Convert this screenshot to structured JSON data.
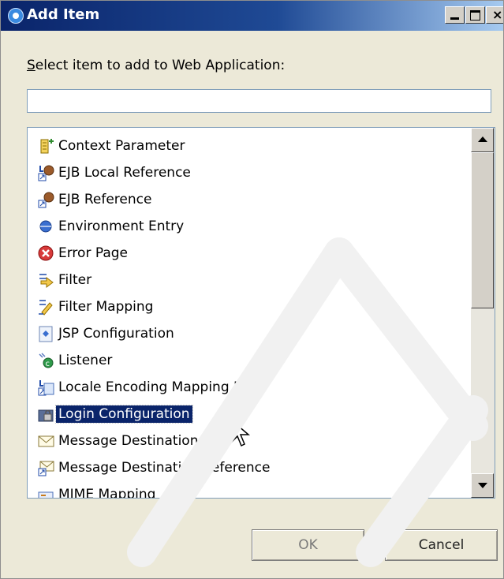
{
  "window": {
    "title": "Add Item"
  },
  "prompt": {
    "before": "",
    "mnemonic": "S",
    "after": "elect item to add to Web Application:"
  },
  "filter": {
    "value": "",
    "placeholder": ""
  },
  "list": {
    "items": [
      {
        "label": "Context Parameter",
        "icon": "context-parameter-icon"
      },
      {
        "label": "EJB Local Reference",
        "icon": "ejb-local-reference-icon"
      },
      {
        "label": "EJB Reference",
        "icon": "ejb-reference-icon"
      },
      {
        "label": "Environment Entry",
        "icon": "environment-entry-icon"
      },
      {
        "label": "Error Page",
        "icon": "error-page-icon"
      },
      {
        "label": "Filter",
        "icon": "filter-icon"
      },
      {
        "label": "Filter Mapping",
        "icon": "filter-mapping-icon"
      },
      {
        "label": "JSP Configuration",
        "icon": "jsp-configuration-icon"
      },
      {
        "label": "Listener",
        "icon": "listener-icon"
      },
      {
        "label": "Locale Encoding Mapping List",
        "icon": "locale-encoding-icon"
      },
      {
        "label": "Login Configuration",
        "icon": "login-configuration-icon"
      },
      {
        "label": "Message Destination",
        "icon": "message-destination-icon"
      },
      {
        "label": "Message Destination Reference",
        "icon": "message-destination-reference-icon"
      },
      {
        "label": "MIME Mapping",
        "icon": "mime-mapping-icon"
      }
    ],
    "selected_index": 10
  },
  "buttons": {
    "ok": "OK",
    "cancel": "Cancel"
  },
  "colors": {
    "title_bar": "#0a246a",
    "selection": "#0a246a",
    "dialog_bg": "#ece9d8"
  }
}
